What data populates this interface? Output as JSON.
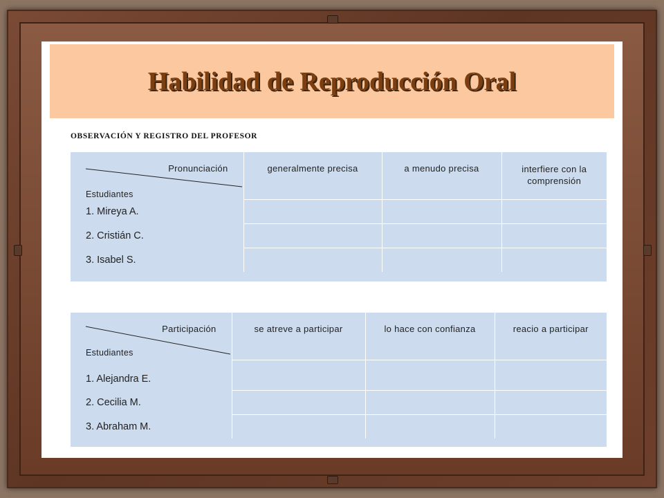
{
  "title": "Habilidad de Reproducción Oral",
  "section_label": "OBSERVACIÓN Y REGISTRO DEL PROFESOR",
  "tables": [
    {
      "diag_top": "Pronunciación",
      "diag_bottom": "Estudiantes",
      "columns": [
        "generalmente precisa",
        "a menudo precisa",
        "interfiere con la comprensión"
      ],
      "students": [
        "1. Mireya A.",
        "2. Cristián C.",
        "3. Isabel S."
      ]
    },
    {
      "diag_top": "Participación",
      "diag_bottom": "Estudiantes",
      "columns": [
        "se atreve a participar",
        "lo hace con confianza",
        "reacio a participar"
      ],
      "students": [
        "1. Alejandra E.",
        "2. Cecilia M.",
        "3. Abraham M."
      ]
    }
  ]
}
